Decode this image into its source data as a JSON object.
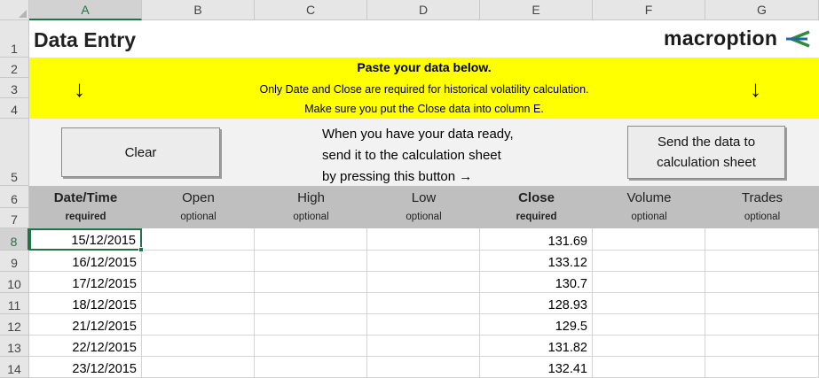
{
  "columns": [
    "A",
    "B",
    "C",
    "D",
    "E",
    "F",
    "G"
  ],
  "rows": [
    "1",
    "2",
    "3",
    "4",
    "5",
    "6",
    "7",
    "8",
    "9",
    "10",
    "11",
    "12",
    "13",
    "14"
  ],
  "title": "Data Entry",
  "logo": {
    "text": "macroption",
    "accent_color": "#2e8b3e"
  },
  "banner": {
    "title": "Paste your data below.",
    "line1": "Only Date and Close are required for historical volatility calculation.",
    "line2": "Make sure you put the Close data into column E.",
    "arrow_left": "↓",
    "arrow_right": "↓",
    "background": "#ffff00"
  },
  "controls": {
    "clear_label": "Clear",
    "instructions": [
      "When you have your data ready,",
      "send it to the calculation sheet",
      "by pressing this button  →"
    ],
    "send_label_1": "Send the data to",
    "send_label_2": "calculation sheet"
  },
  "headers": [
    {
      "name": "Date/Time",
      "sub": "required"
    },
    {
      "name": "Open",
      "sub": "optional"
    },
    {
      "name": "High",
      "sub": "optional"
    },
    {
      "name": "Low",
      "sub": "optional"
    },
    {
      "name": "Close",
      "sub": "required"
    },
    {
      "name": "Volume",
      "sub": "optional"
    },
    {
      "name": "Trades",
      "sub": "optional"
    }
  ],
  "data_rows": [
    {
      "date": "15/12/2015",
      "close": "131.69"
    },
    {
      "date": "16/12/2015",
      "close": "133.12"
    },
    {
      "date": "17/12/2015",
      "close": "130.7"
    },
    {
      "date": "18/12/2015",
      "close": "128.93"
    },
    {
      "date": "21/12/2015",
      "close": "129.5"
    },
    {
      "date": "22/12/2015",
      "close": "131.82"
    },
    {
      "date": "23/12/2015",
      "close": "132.41"
    }
  ],
  "selection": {
    "column": "A",
    "row": "8"
  }
}
